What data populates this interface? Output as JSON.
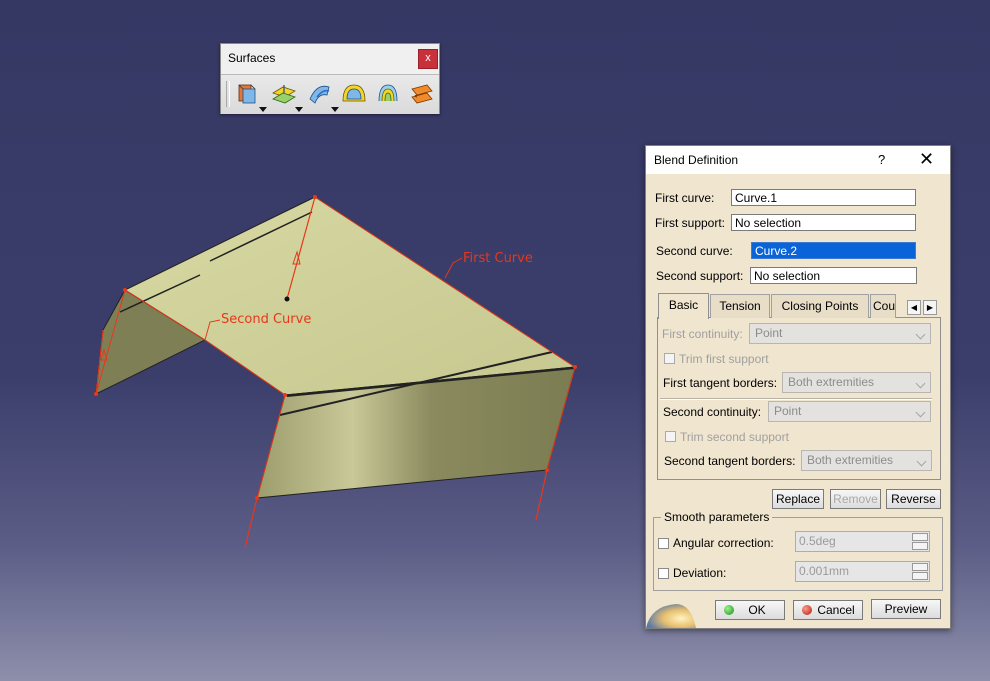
{
  "viewport": {
    "annotations": {
      "first_curve": "First Curve",
      "second_curve": "Second Curve"
    }
  },
  "toolbar": {
    "title": "Surfaces",
    "close_label": "x",
    "buttons": [
      "extrude-icon",
      "offset-icon",
      "sweep-icon",
      "fill-icon",
      "multi-sections-surface-icon",
      "blend-icon"
    ]
  },
  "dialog": {
    "title": "Blend Definition",
    "help_label": "?",
    "close_label": "✕",
    "first_curve_label": "First curve:",
    "first_curve_value": "Curve.1",
    "first_support_label": "First support:",
    "first_support_value": "No selection",
    "second_curve_label": "Second curve:",
    "second_curve_value": "Curve.2",
    "second_support_label": "Second support:",
    "second_support_value": "No selection",
    "tabs": [
      "Basic",
      "Tension",
      "Closing Points",
      "Cou"
    ],
    "basic": {
      "first_continuity_label": "First continuity:",
      "first_continuity_value": "Point",
      "trim_first_support_label": "Trim first support",
      "first_tangent_borders_label": "First tangent borders:",
      "first_tangent_borders_value": "Both extremities",
      "second_continuity_label": "Second continuity:",
      "second_continuity_value": "Point",
      "trim_second_support_label": "Trim second support",
      "second_tangent_borders_label": "Second tangent borders:",
      "second_tangent_borders_value": "Both extremities"
    },
    "replace_label": "Replace",
    "remove_label": "Remove",
    "reverse_label": "Reverse",
    "smooth_title": "Smooth parameters",
    "angular_correction_label": "Angular correction:",
    "angular_correction_value": "0.5deg",
    "deviation_label": "Deviation:",
    "deviation_value": "0.001mm",
    "ok_label": "OK",
    "cancel_label": "Cancel",
    "preview_label": "Preview"
  },
  "colors": {
    "background_top": "#363864",
    "background_bottom": "#8e8fab",
    "surface_top": "#d1d39a",
    "surface_side": "#8a8a5e",
    "curve_highlight": "#e8371a",
    "dialog_bg": "#f0e5cf",
    "selection": "#0a64d8"
  }
}
